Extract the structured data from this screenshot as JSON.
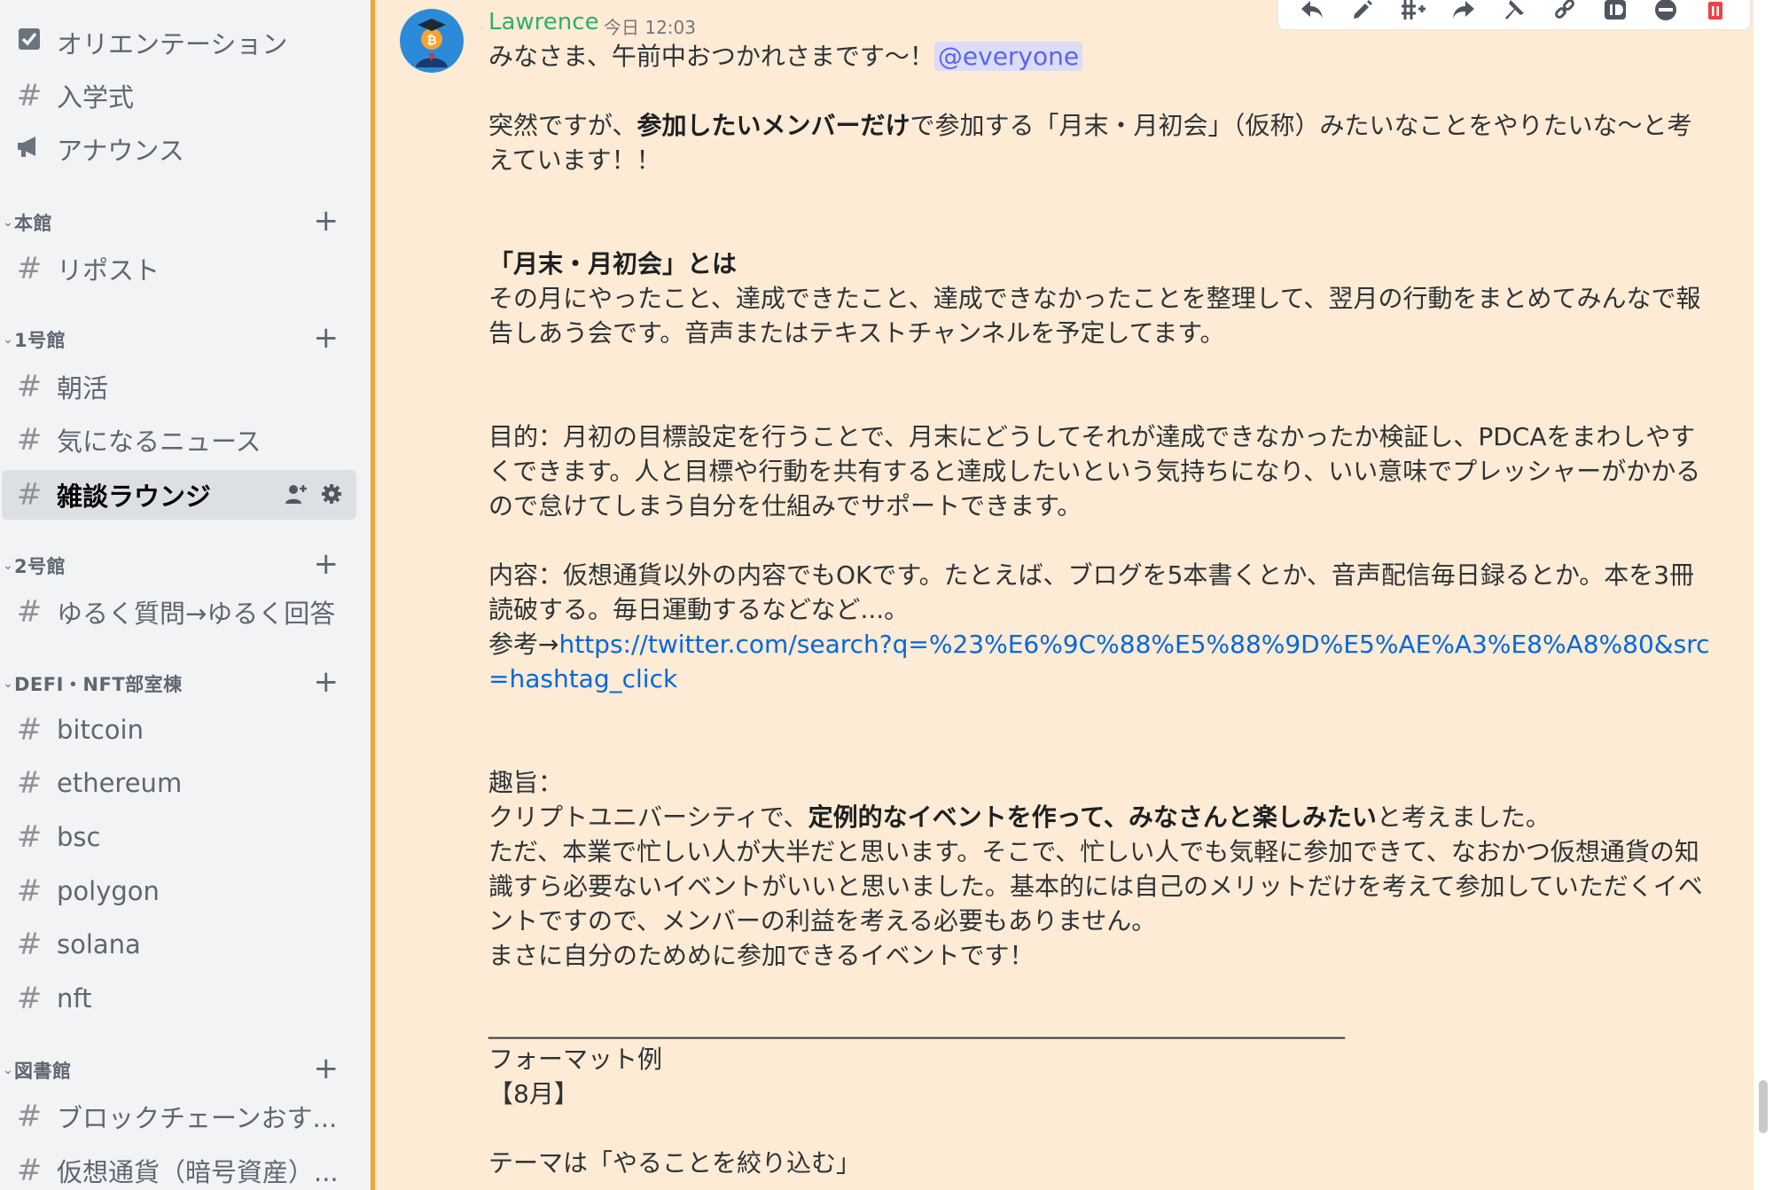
{
  "sidebar": {
    "top_channels": [
      {
        "label": "オリエンテーション",
        "icon": "checkbox-icon"
      },
      {
        "label": "入学式",
        "icon": "hash-icon"
      },
      {
        "label": "アナウンス",
        "icon": "megaphone-icon"
      }
    ],
    "categories": [
      {
        "label": "本館",
        "channels": [
          "リポスト"
        ]
      },
      {
        "label": "1号館",
        "channels": [
          "朝活",
          "気になるニュース",
          "雑談ラウンジ"
        ]
      },
      {
        "label": "2号館",
        "channels": [
          "ゆるく質問→ゆるく回答"
        ]
      },
      {
        "label": "DEFI・NFT部室棟",
        "channels": [
          "bitcoin",
          "ethereum",
          "bsc",
          "polygon",
          "solana",
          "nft"
        ]
      },
      {
        "label": "図書館",
        "channels": [
          "ブロックチェーンおす...",
          "仮想通貨（暗号資産）..."
        ]
      }
    ],
    "hash_glyph": "#",
    "plus_glyph": "+",
    "chevron_glyph": "⌄",
    "active_channel": "雑談ラウンジ"
  },
  "message": {
    "author": "Lawrence",
    "author_color": "#2fae6f",
    "timestamp": "今日 12:03",
    "highlight_color": "#fdebd5",
    "accent_color": "#f0a53a",
    "line1": "みなさま、午前中おつかれさまです〜！",
    "mention": "@everyone",
    "p1_a": "突然ですが、",
    "p1_b": "参加したいメンバーだけ",
    "p1_c": "で参加する「月末・月初会」（仮称）みたいなことをやりたいな〜と考えています！！",
    "h1": "「月末・月初会」とは",
    "p2": "その月にやったこと、達成できたこと、達成できなかったことを整理して、翌月の行動をまとめてみんなで報告しあう会です。音声またはテキストチャンネルを予定してます。",
    "p3": "目的：月初の目標設定を行うことで、月末にどうしてそれが達成できなかったか検証し、PDCAをまわしやすくできます。人と目標や行動を共有すると達成したいという気持ちになり、いい意味でプレッシャーがかかるので怠けてしまう自分を仕組みでサポートできます。",
    "p4": "内容：仮想通貨以外の内容でもOKです。たとえば、ブログを5本書くとか、音声配信毎日録るとか。本を3冊読破する。毎日運動するなどなど...。",
    "ref_prefix": "参考→",
    "ref_link": "https://twitter.com/search?q=%23%E6%9C%88%E5%88%9D%E5%AE%A3%E8%A8%80&src=hashtag_click",
    "p5_title": "趣旨：",
    "p5_a": "クリプトユニバーシティで、",
    "p5_b": "定例的なイベントを作って、みなさんと楽しみたい",
    "p5_c": "と考えました。",
    "p6": "ただ、本業で忙しい人が大半だと思います。そこで、忙しい人でも気軽に参加できて、なおかつ仮想通貨の知識すら必要ないイベントがいいと思いました。基本的には自己のメリットだけを考えて参加していただくイベントですので、メンバーの利益を考える必要もありません。",
    "p7": "まさに自分のためめに参加できるイベントです！",
    "separator": "_____________________________________________________________________",
    "format_title": "フォーマット例",
    "format_month": "【8月】",
    "theme": "テーマは「やることを絞り込む」"
  }
}
